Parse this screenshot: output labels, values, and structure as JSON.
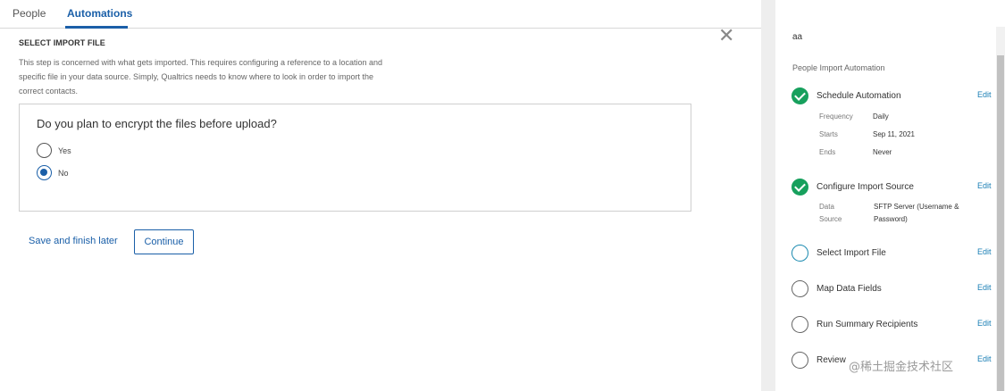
{
  "tabs": [
    {
      "label": "People"
    },
    {
      "label": "Automations"
    }
  ],
  "main": {
    "close_glyph": "✕",
    "step_title": "SELECT IMPORT FILE",
    "step_desc": "This step is concerned with what gets imported. This requires configuring a reference to a location and specific file in your data source. Simply, Qualtrics needs to know where to look in order to import the correct contacts.",
    "question": "Do you plan to encrypt the files before upload?",
    "options": [
      {
        "label": "Yes",
        "selected": false
      },
      {
        "label": "No",
        "selected": true
      }
    ],
    "save_later": "Save and finish later",
    "continue": "Continue"
  },
  "sidebar": {
    "name": "aa",
    "heading": "People Import Automation",
    "edit_label": "Edit",
    "steps": [
      {
        "label": "Schedule Automation",
        "status": "done"
      },
      {
        "label": "Configure Import Source",
        "status": "done"
      },
      {
        "label": "Select Import File",
        "status": "current"
      },
      {
        "label": "Map Data Fields",
        "status": "pending"
      },
      {
        "label": "Run Summary Recipients",
        "status": "pending"
      },
      {
        "label": "Review",
        "status": "pending"
      }
    ],
    "schedule": {
      "frequency_label": "Frequency",
      "frequency": "Daily",
      "starts_label": "Starts",
      "starts": "Sep 11, 2021",
      "ends_label": "Ends",
      "ends": "Never"
    },
    "source": {
      "label_line1": "Data",
      "label_line2": "Source",
      "value_line1": "SFTP Server (Username &",
      "value_line2": "Password)"
    }
  },
  "watermark": "@稀土掘金技术社区",
  "colors": {
    "accent": "#1a5fa8",
    "success": "#17a05d",
    "current": "#1a8ab0"
  }
}
